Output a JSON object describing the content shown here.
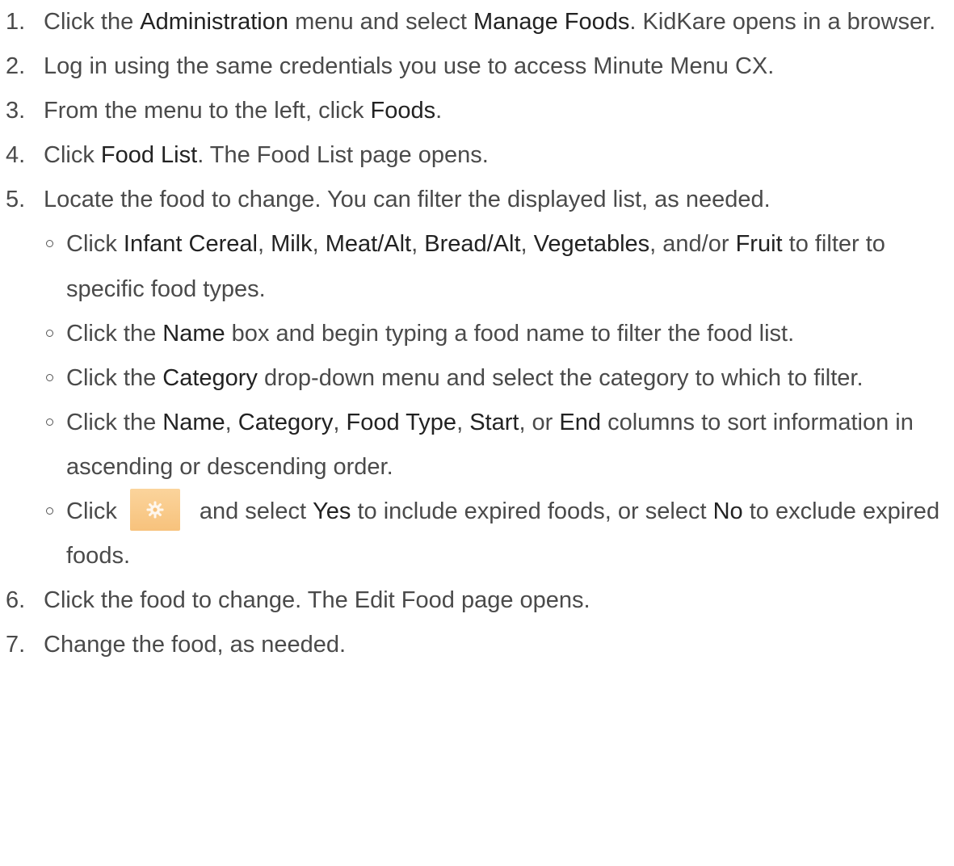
{
  "steps": [
    {
      "num": "1.",
      "parts": [
        {
          "t": "Click the "
        },
        {
          "b": "Administration"
        },
        {
          "t": " menu and select "
        },
        {
          "b": "Manage Foods"
        },
        {
          "t": ". KidKare opens in a browser."
        }
      ]
    },
    {
      "num": "2.",
      "parts": [
        {
          "t": "Log in using the same credentials you use to access Minute Menu CX."
        }
      ]
    },
    {
      "num": "3.",
      "parts": [
        {
          "t": "From the menu to the left, click "
        },
        {
          "b": "Foods"
        },
        {
          "t": "."
        }
      ]
    },
    {
      "num": "4.",
      "parts": [
        {
          "t": "Click "
        },
        {
          "b": "Food List"
        },
        {
          "t": ". The Food List page opens."
        }
      ]
    },
    {
      "num": "5.",
      "parts": [
        {
          "t": "Locate the food to change. You can filter the displayed list, as needed."
        }
      ],
      "subs": [
        [
          {
            "t": "Click "
          },
          {
            "b": "Infant Cereal"
          },
          {
            "t": ", "
          },
          {
            "b": "Milk"
          },
          {
            "t": ", "
          },
          {
            "b": "Meat/Alt"
          },
          {
            "t": ", "
          },
          {
            "b": "Bread/Alt"
          },
          {
            "t": ", "
          },
          {
            "b": "Vegetables"
          },
          {
            "t": ", and/or "
          },
          {
            "b": "Fruit"
          },
          {
            "t": " to filter to specific food types."
          }
        ],
        [
          {
            "t": "Click the "
          },
          {
            "b": "Name"
          },
          {
            "t": " box and begin typing a food name to filter the food list."
          }
        ],
        [
          {
            "t": "Click the "
          },
          {
            "b": "Category"
          },
          {
            "t": " drop-down menu and select the category to which to filter."
          }
        ],
        [
          {
            "t": "Click the "
          },
          {
            "b": "Name"
          },
          {
            "t": ", "
          },
          {
            "b": "Category"
          },
          {
            "t": ", "
          },
          {
            "b": "Food Type"
          },
          {
            "t": ", "
          },
          {
            "b": "Start"
          },
          {
            "t": ", or "
          },
          {
            "b": "End"
          },
          {
            "t": " columns to sort information in ascending or descending order."
          }
        ],
        [
          {
            "t": "Click"
          },
          {
            "icon": "gear-icon",
            "color": "#f7c27c"
          },
          {
            "t": "and select "
          },
          {
            "b": "Yes"
          },
          {
            "t": " to include expired foods, or select "
          },
          {
            "b": "No"
          },
          {
            "t": " to exclude expired foods."
          }
        ]
      ]
    },
    {
      "num": "6.",
      "parts": [
        {
          "t": "Click the food to change. The Edit Food page opens."
        }
      ]
    },
    {
      "num": "7.",
      "parts": [
        {
          "t": "Change the food, as needed."
        }
      ]
    }
  ]
}
